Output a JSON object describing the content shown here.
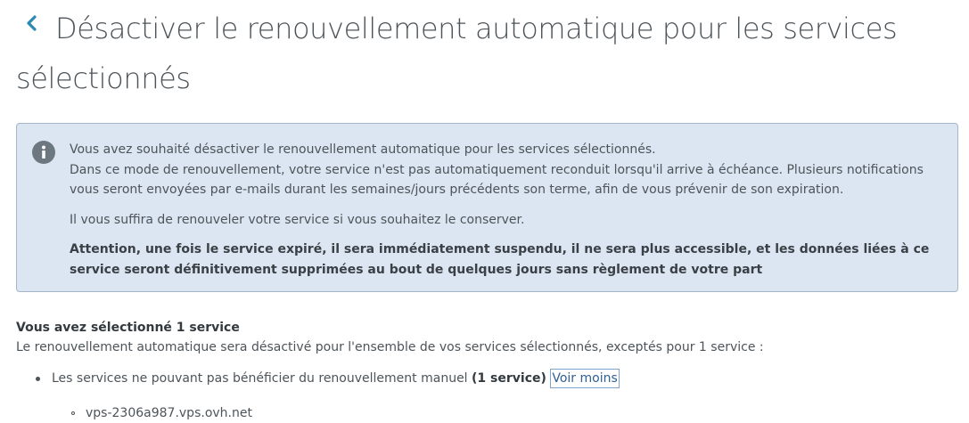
{
  "header": {
    "back_icon": "chevron-left-icon",
    "title": "Désactiver le renouvellement automatique pour les services sélectionnés"
  },
  "info_box": {
    "icon": "info-icon",
    "paragraph1_line1": "Vous avez souhaité désactiver le renouvellement automatique pour les services sélectionnés.",
    "paragraph1_rest": "Dans ce mode de renouvellement, votre service n'est pas automatiquement reconduit lorsqu'il arrive à échéance. Plusieurs notifications vous seront envoyées par e-mails durant les semaines/jours précédents son terme, afin de vous prévenir de son expiration.",
    "paragraph2": "Il vous suffira de renouveler votre service si vous souhaitez le conserver.",
    "warning": "Attention, une fois le service expiré, il sera immédiatement suspendu, il ne sera plus accessible, et les données liées à ce service seront définitivement supprimées au bout de quelques jours sans règlement de votre part"
  },
  "selection": {
    "heading": "Vous avez sélectionné 1 service",
    "description": "Le renouvellement automatique sera désactivé pour l'ensemble de vos services sélectionnés, exceptés pour 1 service :",
    "excluded_label": "Les services ne pouvant pas bénéficier du renouvellement manuel",
    "excluded_count": "(1 service)",
    "toggle_label": "Voir moins",
    "services": [
      {
        "name": "vps-2306a987.vps.ovh.net"
      }
    ]
  },
  "colors": {
    "accent": "#2b8ab5",
    "info_background": "#dbe6f2",
    "info_border": "#a4b6c8",
    "info_icon": "#6c7780"
  }
}
